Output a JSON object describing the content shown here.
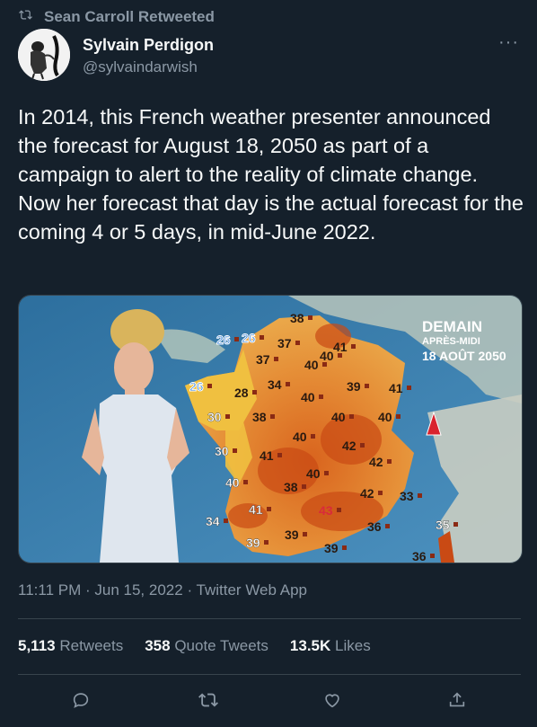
{
  "retweet": {
    "label": "Sean Carroll Retweeted",
    "icon": "retweet-icon"
  },
  "author": {
    "name": "Sylvain Perdigon",
    "handle": "@sylvaindarwish"
  },
  "menu": {
    "icon": "more-icon",
    "label": "···"
  },
  "tweet": {
    "text": "In 2014, this French weather presenter announced the forecast for August 18, 2050 as part of a campaign to alert to the reality of climate change. Now her forecast that day is the actual forecast for the coming 4 or 5 days, in mid-June 2022."
  },
  "map": {
    "title": "DEMAIN",
    "subtitle": "APRÈS-MIDI",
    "date": "18 AOÛT 2050",
    "temps": [
      "38",
      "37",
      "40",
      "41",
      "37",
      "40",
      "26",
      "34",
      "39",
      "41",
      "28",
      "40",
      "30",
      "38",
      "40",
      "40",
      "40",
      "42",
      "30",
      "41",
      "42",
      "40",
      "40",
      "38",
      "42",
      "33",
      "41",
      "43",
      "34",
      "36",
      "35",
      "39",
      "39",
      "39",
      "36",
      "26",
      "26"
    ]
  },
  "meta": {
    "time": "11:11 PM",
    "date": "Jun 15, 2022",
    "client": "Twitter Web App",
    "sep": "·"
  },
  "stats": {
    "retweets_count": "5,113",
    "retweets_label": "Retweets",
    "quotes_count": "358",
    "quotes_label": "Quote Tweets",
    "likes_count": "13.5K",
    "likes_label": "Likes"
  },
  "actions": [
    "reply-icon",
    "retweet-icon",
    "like-icon",
    "share-icon"
  ],
  "colors": {
    "background": "#15202b",
    "text": "#f7f9f9",
    "secondary": "#8b98a5",
    "border": "#38444d"
  }
}
